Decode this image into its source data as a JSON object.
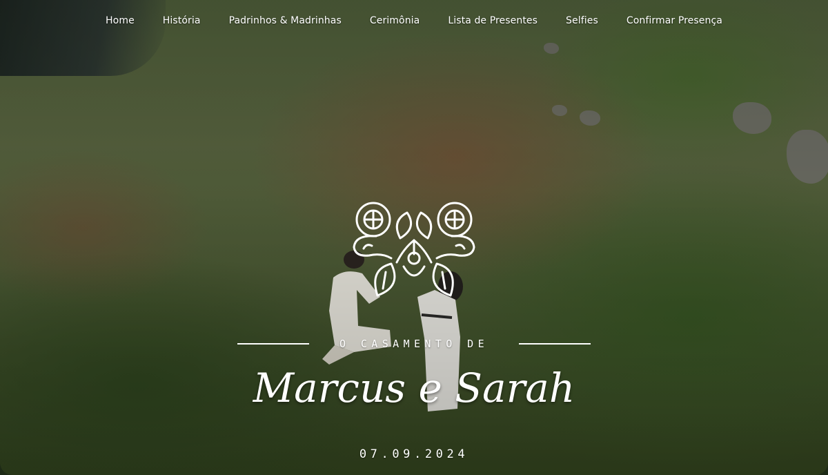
{
  "nav": {
    "items": [
      {
        "label": "Home"
      },
      {
        "label": "História"
      },
      {
        "label": "Padrinhos & Madrinhas"
      },
      {
        "label": "Cerimônia"
      },
      {
        "label": "Lista de Presentes"
      },
      {
        "label": "Selfies"
      },
      {
        "label": "Confirmar Presença"
      }
    ]
  },
  "hero": {
    "subtitle": "O CASAMENTO DE",
    "names": "Marcus e Sarah",
    "date": "07.09.2024",
    "emblem_icon": "floral-emblem-icon",
    "background": "aerial-photo-couple-proposal"
  },
  "colors": {
    "text": "#ffffff",
    "grass": "#4c5a35",
    "dirt": "#7a4630"
  }
}
